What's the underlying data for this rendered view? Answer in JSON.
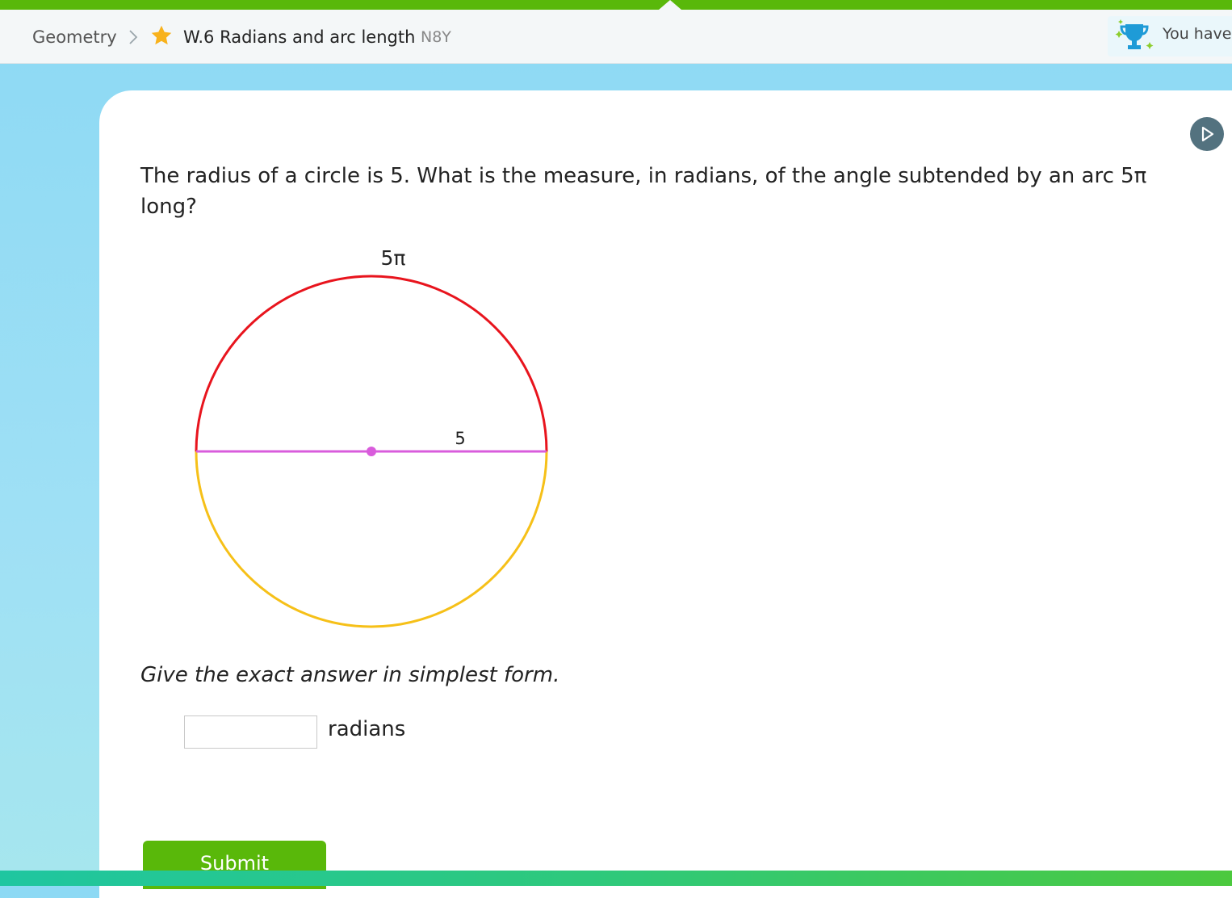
{
  "header": {
    "subject": "Geometry",
    "skill": "W.6 Radians and arc length",
    "skill_code": "N8Y",
    "award_text": "You have"
  },
  "question": {
    "prompt": "The radius of a circle is 5. What is the measure, in radians, of the angle subtended by an arc 5π long?",
    "diagram": {
      "arc_label": "5π",
      "radius_label": "5",
      "colors": {
        "arc": "#e8141d",
        "rest_of_circle": "#f6c018",
        "diameter": "#d95cdc",
        "center": "#d95cdc"
      }
    },
    "instruction": "Give the exact answer in simplest form.",
    "answer_value": "",
    "unit": "radians"
  },
  "submit_label": "Submit",
  "colors": {
    "accent_green": "#59b80a",
    "background_blue": "#8dd9f4"
  },
  "icons": [
    "chevron-right-icon",
    "star-icon",
    "trophy-icon",
    "play-icon"
  ]
}
